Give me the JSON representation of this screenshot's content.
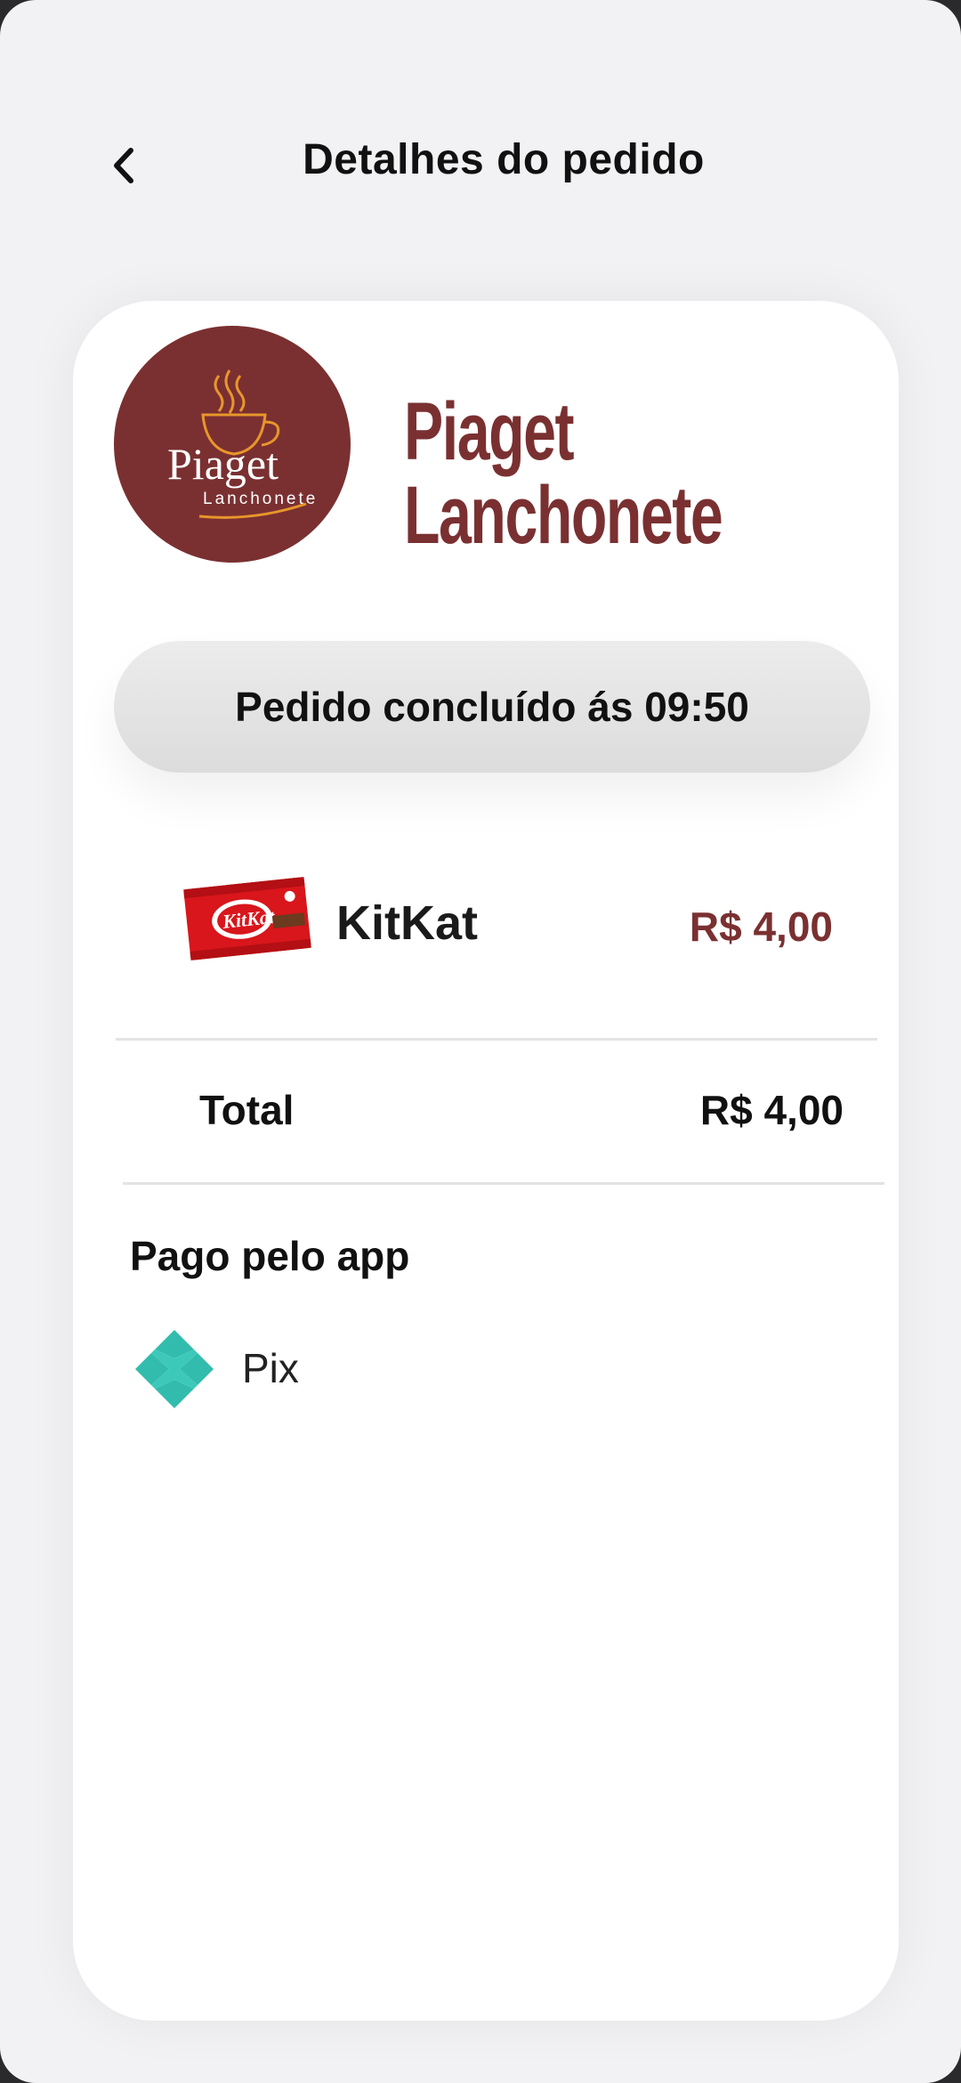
{
  "header": {
    "title": "Detalhes do pedido",
    "back_icon": "chevron-left-icon"
  },
  "store": {
    "name_line1": "Piaget",
    "name_line2": "Lanchonete",
    "logo_text_main": "Piaget",
    "logo_text_sub": "Lanchonete",
    "brand_color": "#7a3031"
  },
  "order": {
    "status": "Pedido concluído ás 09:50",
    "items": [
      {
        "name": "KitKat",
        "price": "R$ 4,00",
        "image": "kitkat-product-image"
      }
    ],
    "total_label": "Total",
    "total_value": "R$ 4,00"
  },
  "payment": {
    "label": "Pago pelo app",
    "method": "Pix",
    "method_icon": "pix-icon",
    "method_color": "#32bcad"
  }
}
